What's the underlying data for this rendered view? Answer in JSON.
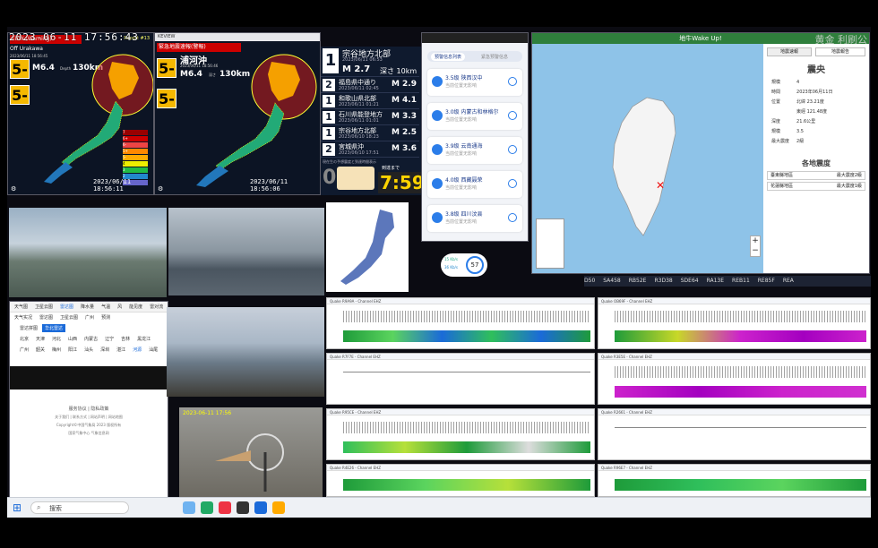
{
  "overlay": {
    "clock": "2023-06-11 17:56:43",
    "watermark": "黄金 利刷公"
  },
  "jp_map_left": {
    "title": "EEW (Warning)",
    "subtitle": "Report #13",
    "region": "Off Urakawa",
    "date": "2023/06/11 18:56:45",
    "shindo_main": "5-",
    "shindo_second": "5-",
    "magnitude": "M6.4",
    "depth_label": "Depth",
    "depth": "130km",
    "legend": [
      "Shindo 7",
      "Shindo 6+",
      "Shindo 6-",
      "Shindo 5+",
      "Shindo 5-",
      "Shindo 4",
      "Shindo 3",
      "Shindo 2",
      "Shindo 1"
    ],
    "footer": "2023/06/11 18:56:11"
  },
  "jp_map_right": {
    "window_title": "KEVIEW",
    "title": "緊急地震速報(警報)",
    "region": "浦河沖",
    "date": "2023/06/11 18:56:46",
    "shindo_main": "5-",
    "shindo_second": "5-",
    "magnitude": "M6.4",
    "depth_label": "深さ",
    "depth": "130km",
    "footer": "2023/06/11 18:56:06"
  },
  "quake_list": {
    "rows": [
      {
        "intensity": "1",
        "place": "宗谷地方北部",
        "time": "2023/06/11 06:53",
        "mag": "M 2.7",
        "depth": "深さ 10km"
      },
      {
        "intensity": "2",
        "place": "福島県中通り",
        "time": "2023/06/11 02:45",
        "mag": "M 2.9"
      },
      {
        "intensity": "1",
        "place": "和歌山県北部",
        "time": "2023/06/11 01:21",
        "mag": "M 4.1"
      },
      {
        "intensity": "1",
        "place": "石川県能登地方",
        "time": "2023/06/11 01:01",
        "mag": "M 3.3"
      },
      {
        "intensity": "1",
        "place": "宗谷地方北部",
        "time": "2023/06/10 18:23",
        "mag": "M 2.5"
      },
      {
        "intensity": "2",
        "place": "宮城県沖",
        "time": "2023/06/10 17:51",
        "mag": "M 3.6"
      }
    ],
    "footer_label": "現在生の予想震度と到達時間表示",
    "countdown_label": "到達まで",
    "countdown": "7:59",
    "zero": "0"
  },
  "phone_app": {
    "tabs": [
      "预警信息列表",
      "紧急预警信息"
    ],
    "cards": [
      {
        "title": "3.5级 陕西汉中",
        "sub": "当前位置无影响"
      },
      {
        "title": "3.0级 内蒙古和林格尔",
        "sub": "当前位置无影响"
      },
      {
        "title": "3.9级 云南通海",
        "sub": "当前位置无影响"
      },
      {
        "title": "4.0级 西藏聂荣",
        "sub": "当前位置无影响"
      },
      {
        "title": "3.8级 四川汶县",
        "sub": "当前位置无影响"
      }
    ],
    "gauge": "57",
    "gauge_up": "15 Kb/s",
    "gauge_down": "36 Kb/s"
  },
  "taiwan": {
    "title": "地牛Wake Up!",
    "tab_left": "地震速報",
    "tab_right": "地震報告",
    "epicenter_title": "震央",
    "info": [
      {
        "k": "規模",
        "v": "4"
      },
      {
        "k": "時間",
        "v": "2023年06月11日"
      },
      {
        "k": "位置",
        "v": "北緯 23.21度"
      },
      {
        "k": "",
        "v": "東經 121.48度"
      },
      {
        "k": "深度",
        "v": "21.6公里"
      },
      {
        "k": "規模",
        "v": "3.5"
      },
      {
        "k": "最大震度",
        "v": "2級"
      }
    ],
    "local_title": "各地震度",
    "local": [
      {
        "area": "臺東縣地區",
        "val": "最大震度2級"
      },
      {
        "area": "花蓮縣地區",
        "val": "最大震度1級"
      }
    ]
  },
  "stations": [
    "D50",
    "SA458",
    "RB52E",
    "R3D38",
    "SDE64",
    "RA13E",
    "REB11",
    "RE85F",
    "REA"
  ],
  "seismograms": [
    {
      "label": "Quake R9A9A - Channel EHZ",
      "kind": "active"
    },
    {
      "label": "Quake OB69F - Channel EHZ",
      "kind": "active-magenta"
    },
    {
      "label": "Quake R7F7E - Channel EHZ",
      "kind": "quiet"
    },
    {
      "label": "Quake R3E5E - Channel EHZ",
      "kind": "active-magenta2"
    },
    {
      "label": "Quake R95CE - Channel EHZ",
      "kind": "active"
    },
    {
      "label": "Quake R2661 - Channel EHZ",
      "kind": "quiet"
    },
    {
      "label": "Quake R4E26 - Channel EHZ",
      "kind": "active"
    },
    {
      "label": "Quake R96E7 - Channel EHZ",
      "kind": "active"
    }
  ],
  "weather_browser": {
    "tabs": [
      "天气图",
      "卫星云图",
      "雷达图",
      "降水量",
      "气温",
      "风",
      "能见度",
      "雷对流"
    ],
    "chips": [
      "天气实况",
      "雷达图",
      "卫星云图",
      "广州",
      "预测"
    ],
    "region_label": "雷达拼图",
    "region_sel": "华北雷达",
    "cities_1": [
      "北京",
      "天津",
      "河北",
      "山西",
      "内蒙古",
      "辽宁",
      "吉林",
      "黑龙江"
    ],
    "cities_2": [
      "广州",
      "韶关",
      "梅州",
      "阳江",
      "汕头",
      "深圳",
      "湛江",
      "河源",
      "汕尾"
    ],
    "footer_1": "服务协议 | 隐私政策",
    "footer_2": "关于我们 | 联系方式 | 网站声明 | 网站地图",
    "footer_3": "Copyright©中国气象局 2023 版权所有",
    "footer_4": "国家气象中心 气象信息网"
  },
  "cam_small": {
    "stamp": "2023-06-11 17:56"
  },
  "taskbar": {
    "search": "搜索"
  }
}
